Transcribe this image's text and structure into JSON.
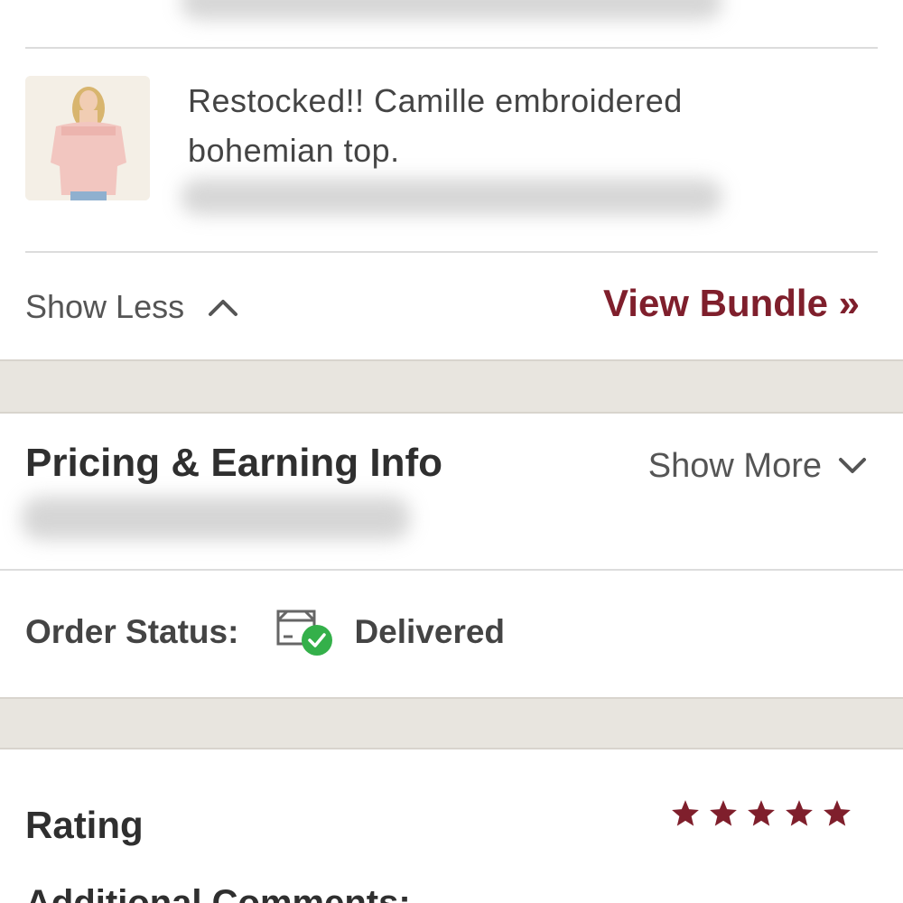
{
  "item": {
    "title": "Restocked!! Camille embroidered bohemian top."
  },
  "actions": {
    "show_less": "Show Less",
    "view_bundle": "View Bundle »"
  },
  "pricing": {
    "title": "Pricing & Earning Info",
    "show_more": "Show More"
  },
  "order": {
    "status_label": "Order Status:",
    "status_value": "Delivered",
    "status_icon": "box-delivered-icon",
    "status_color": "#34b04a"
  },
  "rating": {
    "label": "Rating",
    "stars": 5,
    "star_color": "#7f1f2c",
    "comments_label": "Additional Comments:"
  },
  "colors": {
    "accent": "#7f1f2c",
    "band": "#e8e5df"
  }
}
